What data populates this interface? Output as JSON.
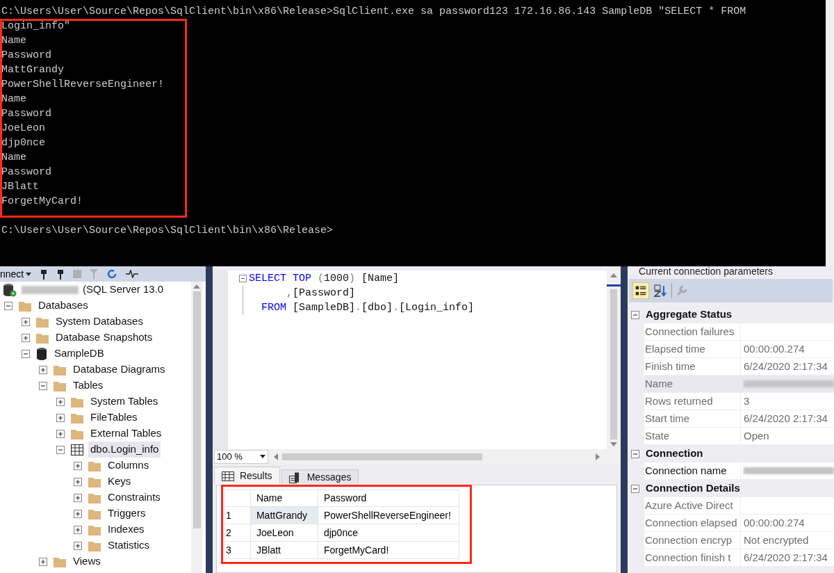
{
  "console": {
    "highlighted": true,
    "prompt": "C:\\Users\\User\\Source\\Repos\\SqlClient\\bin\\x86\\Release>",
    "lines": [
      "C:\\Users\\User\\Source\\Repos\\SqlClient\\bin\\x86\\Release>SqlClient.exe sa password123 172.16.86.143 SampleDB \"SELECT * FROM",
      "Login_info\"",
      "Name",
      "Password",
      "MattGrandy",
      "PowerShellReverseEngineer!",
      "Name",
      "Password",
      "JoeLeon",
      "djp0nce",
      "Name",
      "Password",
      "JBlatt",
      "ForgetMyCard!"
    ]
  },
  "object_explorer": {
    "toolbar_label": "nnect",
    "tree": [
      {
        "kind": "server",
        "label": "(SQL Server 13.0",
        "expanded": true,
        "selected": false,
        "children": [
          {
            "kind": "folder",
            "label": "Databases",
            "expanded": true,
            "selected": false,
            "children": [
              {
                "kind": "folder",
                "label": "System Databases",
                "expanded": false,
                "selected": false
              },
              {
                "kind": "folder",
                "label": "Database Snapshots",
                "expanded": false,
                "selected": false
              },
              {
                "kind": "database",
                "label": "SampleDB",
                "expanded": true,
                "selected": false,
                "children": [
                  {
                    "kind": "folder",
                    "label": "Database Diagrams",
                    "expanded": false,
                    "selected": false
                  },
                  {
                    "kind": "folder",
                    "label": "Tables",
                    "expanded": true,
                    "selected": false,
                    "children": [
                      {
                        "kind": "folder",
                        "label": "System Tables",
                        "expanded": false,
                        "selected": false
                      },
                      {
                        "kind": "folder",
                        "label": "FileTables",
                        "expanded": false,
                        "selected": false
                      },
                      {
                        "kind": "folder",
                        "label": "External Tables",
                        "expanded": false,
                        "selected": false
                      },
                      {
                        "kind": "table",
                        "label": "dbo.Login_info",
                        "expanded": true,
                        "selected": true,
                        "children": [
                          {
                            "kind": "folder",
                            "label": "Columns",
                            "expanded": false,
                            "selected": false
                          },
                          {
                            "kind": "folder",
                            "label": "Keys",
                            "expanded": false,
                            "selected": false
                          },
                          {
                            "kind": "folder",
                            "label": "Constraints",
                            "expanded": false,
                            "selected": false
                          },
                          {
                            "kind": "folder",
                            "label": "Triggers",
                            "expanded": false,
                            "selected": false
                          },
                          {
                            "kind": "folder",
                            "label": "Indexes",
                            "expanded": false,
                            "selected": false
                          },
                          {
                            "kind": "folder",
                            "label": "Statistics",
                            "expanded": false,
                            "selected": false
                          }
                        ]
                      }
                    ]
                  },
                  {
                    "kind": "folder",
                    "label": "Views",
                    "expanded": false,
                    "selected": false
                  }
                ]
              }
            ]
          }
        ]
      }
    ]
  },
  "editor": {
    "code_lines": [
      [
        {
          "kind": "keyword",
          "text": "SELECT"
        },
        {
          "kind": "keyword",
          "text": " TOP"
        },
        {
          "kind": "operator",
          "text": " ("
        },
        {
          "kind": "plain",
          "text": "1000"
        },
        {
          "kind": "operator",
          "text": ")"
        },
        {
          "kind": "plain",
          "text": " [Name]"
        }
      ],
      [
        {
          "kind": "operator",
          "text": "      ,"
        },
        {
          "kind": "plain",
          "text": "[Password]"
        }
      ],
      [
        {
          "kind": "keyword",
          "text": "  FROM"
        },
        {
          "kind": "plain",
          "text": " [SampleDB]"
        },
        {
          "kind": "operator",
          "text": "."
        },
        {
          "kind": "plain",
          "text": "[dbo]"
        },
        {
          "kind": "operator",
          "text": "."
        },
        {
          "kind": "plain",
          "text": "[Login_info]"
        }
      ]
    ],
    "zoom": "100 %"
  },
  "result_tabs": [
    {
      "label": "Results",
      "kind": "grid",
      "selected": true
    },
    {
      "label": "Messages",
      "kind": "messages",
      "selected": false
    }
  ],
  "results": {
    "highlighted": true,
    "columns": [
      "Name",
      "Password"
    ],
    "rows": [
      {
        "number": "1",
        "cells": [
          "MattGrandy",
          "PowerShellReverseEngineer!"
        ],
        "selected": true
      },
      {
        "number": "2",
        "cells": [
          "JoeLeon",
          "djp0nce"
        ],
        "selected": false
      },
      {
        "number": "3",
        "cells": [
          "JBlatt",
          "ForgetMyCard!"
        ],
        "selected": false
      }
    ]
  },
  "properties": {
    "title": "Current connection parameters",
    "categories": [
      {
        "label": "Aggregate Status",
        "expanded": true,
        "rows": [
          {
            "name": "Connection failures",
            "disabled": true,
            "selected": false,
            "redacted": false
          },
          {
            "name": "Elapsed time",
            "value": "00:00:00.274",
            "disabled": true,
            "selected": false,
            "redacted": false
          },
          {
            "name": "Finish time",
            "value": "6/24/2020 2:17:34",
            "disabled": true,
            "selected": false,
            "redacted": false
          },
          {
            "name": "Name",
            "disabled": true,
            "selected": true,
            "redacted": true
          },
          {
            "name": "Rows returned",
            "value": "3",
            "disabled": true,
            "selected": false,
            "redacted": false
          },
          {
            "name": "Start time",
            "value": "6/24/2020 2:17:34",
            "disabled": true,
            "selected": false,
            "redacted": false
          },
          {
            "name": "State",
            "value": "Open",
            "disabled": true,
            "selected": false,
            "redacted": false
          }
        ]
      },
      {
        "label": "Connection",
        "expanded": true,
        "rows": [
          {
            "name": "Connection name",
            "disabled": false,
            "selected": false,
            "redacted": true
          }
        ]
      },
      {
        "label": "Connection Details",
        "expanded": true,
        "rows": [
          {
            "name": "Azure Active Direct",
            "disabled": true,
            "selected": false,
            "redacted": false
          },
          {
            "name": "Connection elapsed",
            "value": "00:00:00.274",
            "disabled": true,
            "selected": false,
            "redacted": false
          },
          {
            "name": "Connection encryp",
            "value": "Not encrypted",
            "disabled": true,
            "selected": false,
            "redacted": false
          },
          {
            "name": "Connection finish t",
            "value": "6/24/2020 2:17:34",
            "disabled": true,
            "selected": false,
            "redacted": false
          }
        ]
      }
    ]
  }
}
